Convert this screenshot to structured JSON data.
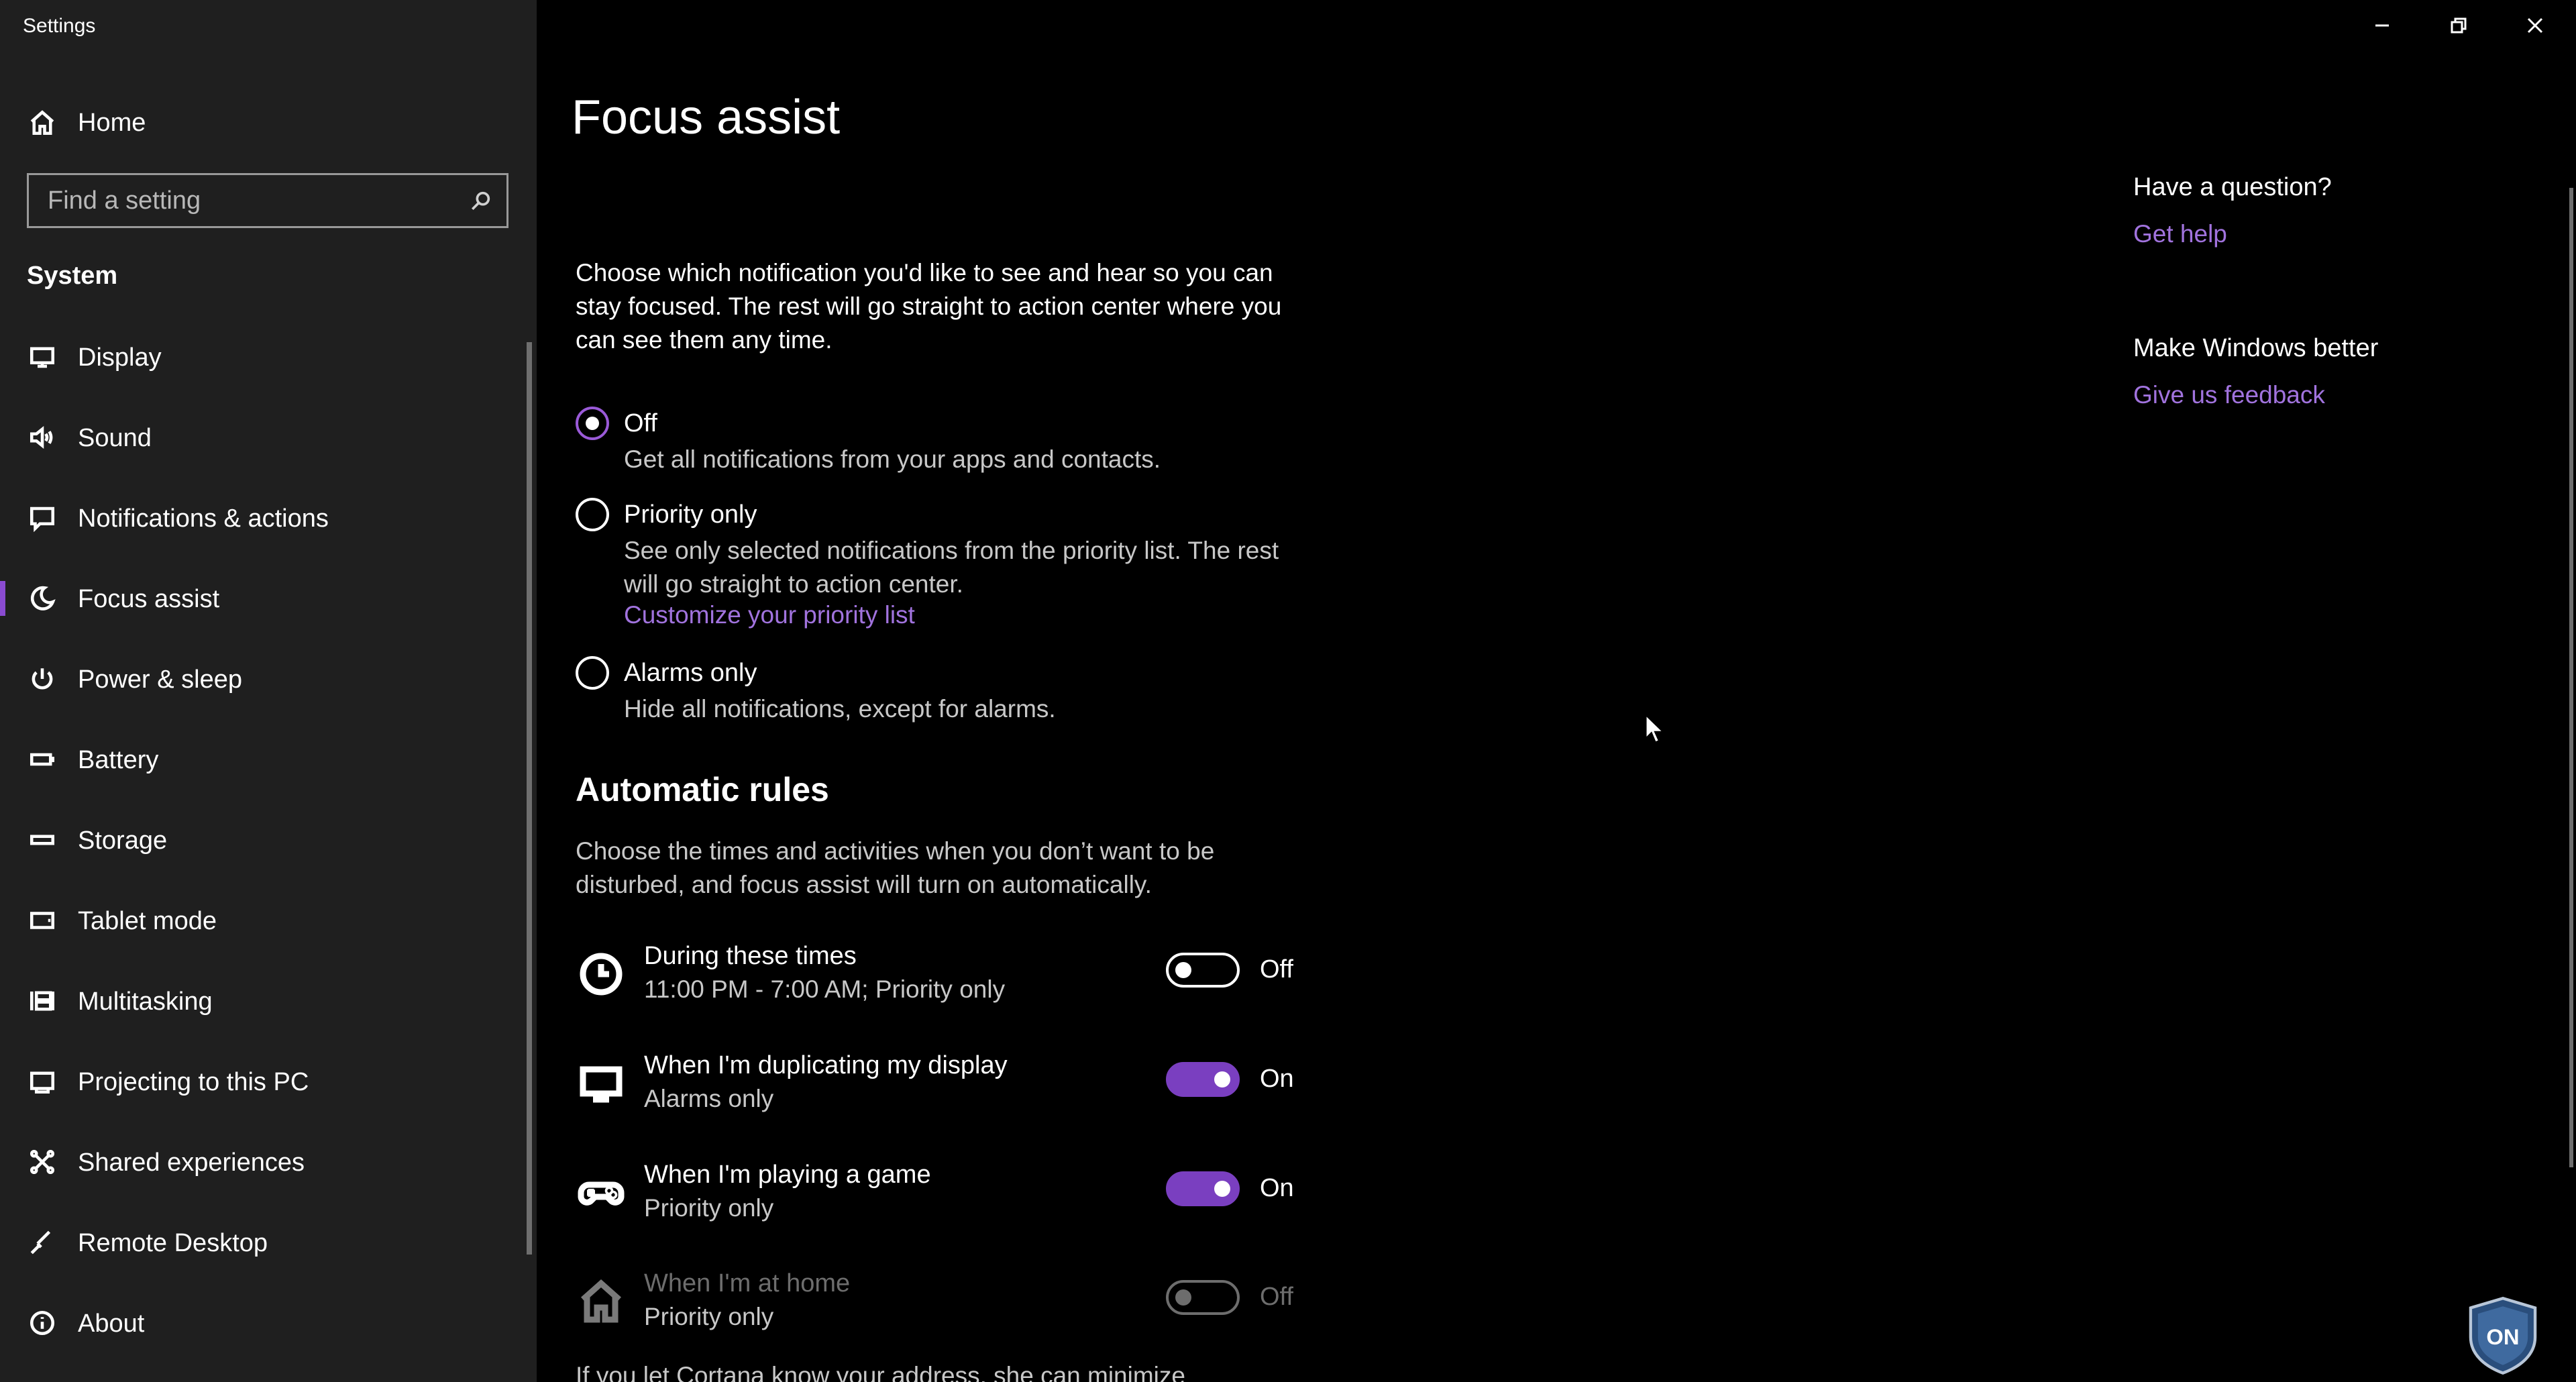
{
  "window": {
    "title": "Settings",
    "minimize_icon": "minimize-icon",
    "restore_icon": "restore-icon",
    "close_icon": "close-icon"
  },
  "nav": {
    "home_label": "Home",
    "search_placeholder": "Find a setting",
    "section_title": "System",
    "items": [
      {
        "label": "Display",
        "icon": "monitor-icon"
      },
      {
        "label": "Sound",
        "icon": "speaker-icon"
      },
      {
        "label": "Notifications & actions",
        "icon": "notification-icon"
      },
      {
        "label": "Focus assist",
        "icon": "moon-icon",
        "selected": true
      },
      {
        "label": "Power & sleep",
        "icon": "power-icon"
      },
      {
        "label": "Battery",
        "icon": "battery-icon"
      },
      {
        "label": "Storage",
        "icon": "storage-icon"
      },
      {
        "label": "Tablet mode",
        "icon": "tablet-icon"
      },
      {
        "label": "Multitasking",
        "icon": "multitasking-icon"
      },
      {
        "label": "Projecting to this PC",
        "icon": "projecting-icon"
      },
      {
        "label": "Shared experiences",
        "icon": "shared-icon"
      },
      {
        "label": "Remote Desktop",
        "icon": "remote-desktop-icon"
      },
      {
        "label": "About",
        "icon": "info-icon"
      }
    ]
  },
  "main": {
    "title": "Focus assist",
    "intro": "Choose which notification you'd like to see and hear so you can stay focused. The rest will go straight to action center where you can see them any time.",
    "options": [
      {
        "label": "Off",
        "desc": "Get all notifications from your apps and contacts.",
        "checked": true
      },
      {
        "label": "Priority only",
        "desc": "See only selected notifications from the priority list. The rest will go straight to action center.",
        "link": "Customize your priority list",
        "checked": false
      },
      {
        "label": "Alarms only",
        "desc": "Hide all notifications, except for alarms.",
        "checked": false
      }
    ],
    "rules_title": "Automatic rules",
    "rules_desc": "Choose the times and activities when you don’t want to be disturbed, and focus assist will turn on automatically.",
    "rules": [
      {
        "title": "During these times",
        "sub": "11:00 PM - 7:00 AM; Priority only",
        "state": "Off",
        "on": false,
        "icon": "clock-icon",
        "disabled": false
      },
      {
        "title": "When I'm duplicating my display",
        "sub": "Alarms only",
        "state": "On",
        "on": true,
        "icon": "monitor-icon",
        "disabled": false
      },
      {
        "title": "When I'm playing a game",
        "sub": "Priority only",
        "state": "On",
        "on": true,
        "icon": "gamepad-icon",
        "disabled": false
      },
      {
        "title": "When I'm at home",
        "sub": "Priority only",
        "state": "Off",
        "on": false,
        "icon": "home-icon",
        "disabled": true
      }
    ],
    "cortana_text": "If you let Cortana know your address, she can minimize"
  },
  "help": {
    "question_title": "Have a question?",
    "get_help": "Get help",
    "better_title": "Make Windows better",
    "feedback": "Give us feedback"
  },
  "colors": {
    "accent": "#8a4bd1",
    "link": "#a173de",
    "nav_bg": "#1f1f1f",
    "content_bg": "#000000"
  },
  "badge_text": "ON"
}
